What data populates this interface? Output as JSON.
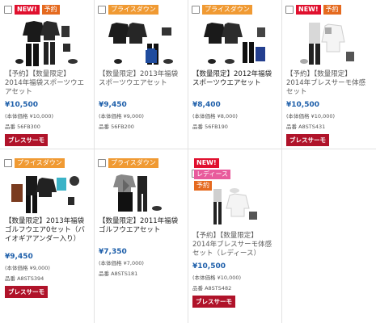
{
  "colors": {
    "new": "#e0102e",
    "preorder": "#e56a1f",
    "price_down": "#f09a33",
    "ladies": "#e85b9c",
    "price": "#1e5faa",
    "brand_badge": "#b0132a"
  },
  "products": [
    {
      "tags": [
        "NEW!",
        "予約"
      ],
      "title": "【予約】【数量限定】2014年福袋スポーツウエアセット",
      "price": "¥10,500",
      "list_price": "(本体価格 ¥10,000)",
      "code": "品番 56FB300",
      "brand": "ブレスサーモ"
    },
    {
      "tags": [
        "プライスダウン"
      ],
      "title": "【数量限定】2013年福袋スポーツウエアセット",
      "price": "¥9,450",
      "list_price": "(本体価格 ¥9,000)",
      "code": "品番 56FB200"
    },
    {
      "tags": [
        "プライスダウン"
      ],
      "title": "【数量限定】2012年福袋スポーツウエアセット",
      "price": "¥8,400",
      "list_price": "(本体価格 ¥8,000)",
      "code": "品番 56FB190"
    },
    {
      "tags": [
        "NEW!",
        "予約"
      ],
      "title": "【予約】【数量限定】2014年ブレスサーモ体感セット",
      "price": "¥10,500",
      "list_price": "(本体価格 ¥10,000)",
      "code": "品番 A8STS431",
      "brand": "ブレスサーモ"
    },
    {
      "tags": [
        "プライスダウン"
      ],
      "title": "【数量限定】2013年福袋ゴルフウエア0セット（バイオギアアンダー入り）",
      "price": "¥9,450",
      "list_price": "(本体価格 ¥9,000)",
      "code": "品番 A8STS394",
      "brand": "ブレスサーモ"
    },
    {
      "tags": [
        "プライスダウン"
      ],
      "title": "【数量限定】2011年福袋ゴルフウエアセット",
      "price": "¥7,350",
      "list_price": "(本体価格 ¥7,000)",
      "code": "品番 A8STS181"
    },
    {
      "tags": [
        "NEW!",
        "レディース",
        "予約"
      ],
      "title": "【予約】【数量限定】2014年ブレスサーモ体感セット（レディース）",
      "price": "¥10,500",
      "list_price": "(本体価格 ¥10,000)",
      "code": "品番 A8STS482",
      "brand": "ブレスサーモ"
    }
  ]
}
